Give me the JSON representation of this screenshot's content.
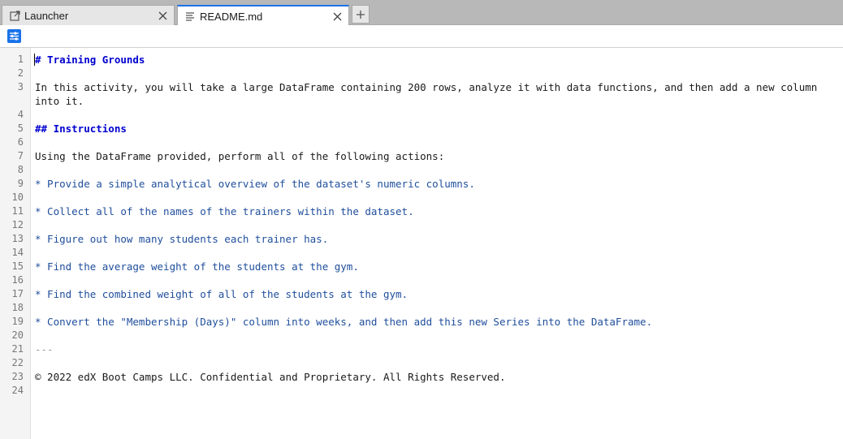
{
  "tabs": [
    {
      "label": "Launcher",
      "icon": "launcher-icon",
      "active": false
    },
    {
      "label": "README.md",
      "icon": "markdown-file-icon",
      "active": true
    }
  ],
  "tab_close_glyph": "✕",
  "tab_add_glyph": "+",
  "toolbar": {
    "settings_icon": "settings-sliders-icon",
    "accent": "#1a73e8"
  },
  "editor": {
    "lines": [
      {
        "num": "1",
        "text": "# Training Grounds",
        "kind": "heading"
      },
      {
        "num": "2",
        "text": "",
        "kind": "plain"
      },
      {
        "num": "3",
        "text": "In this activity, you will take a large DataFrame containing 200 rows, analyze it with data functions, and then add a new column into it.",
        "kind": "plain"
      },
      {
        "num": "4",
        "text": "",
        "kind": "plain"
      },
      {
        "num": "5",
        "text": "## Instructions",
        "kind": "heading"
      },
      {
        "num": "6",
        "text": "",
        "kind": "plain"
      },
      {
        "num": "7",
        "text": "Using the DataFrame provided, perform all of the following actions:",
        "kind": "plain"
      },
      {
        "num": "8",
        "text": "",
        "kind": "plain"
      },
      {
        "num": "9",
        "text": "* Provide a simple analytical overview of the dataset's numeric columns.",
        "kind": "list"
      },
      {
        "num": "10",
        "text": "",
        "kind": "plain"
      },
      {
        "num": "11",
        "text": "* Collect all of the names of the trainers within the dataset.",
        "kind": "list"
      },
      {
        "num": "12",
        "text": "",
        "kind": "plain"
      },
      {
        "num": "13",
        "text": "* Figure out how many students each trainer has.",
        "kind": "list"
      },
      {
        "num": "14",
        "text": "",
        "kind": "plain"
      },
      {
        "num": "15",
        "text": "* Find the average weight of the students at the gym.",
        "kind": "list"
      },
      {
        "num": "16",
        "text": "",
        "kind": "plain"
      },
      {
        "num": "17",
        "text": "* Find the combined weight of all of the students at the gym.",
        "kind": "list"
      },
      {
        "num": "18",
        "text": "",
        "kind": "plain"
      },
      {
        "num": "19",
        "text": "* Convert the \"Membership (Days)\" column into weeks, and then add this new Series into the DataFrame.",
        "kind": "list"
      },
      {
        "num": "20",
        "text": "",
        "kind": "plain"
      },
      {
        "num": "21",
        "text": "---",
        "kind": "hr"
      },
      {
        "num": "22",
        "text": "",
        "kind": "plain"
      },
      {
        "num": "23",
        "text": "© 2022 edX Boot Camps LLC. Confidential and Proprietary. All Rights Reserved.",
        "kind": "plain"
      },
      {
        "num": "24",
        "text": "",
        "kind": "plain"
      }
    ]
  }
}
